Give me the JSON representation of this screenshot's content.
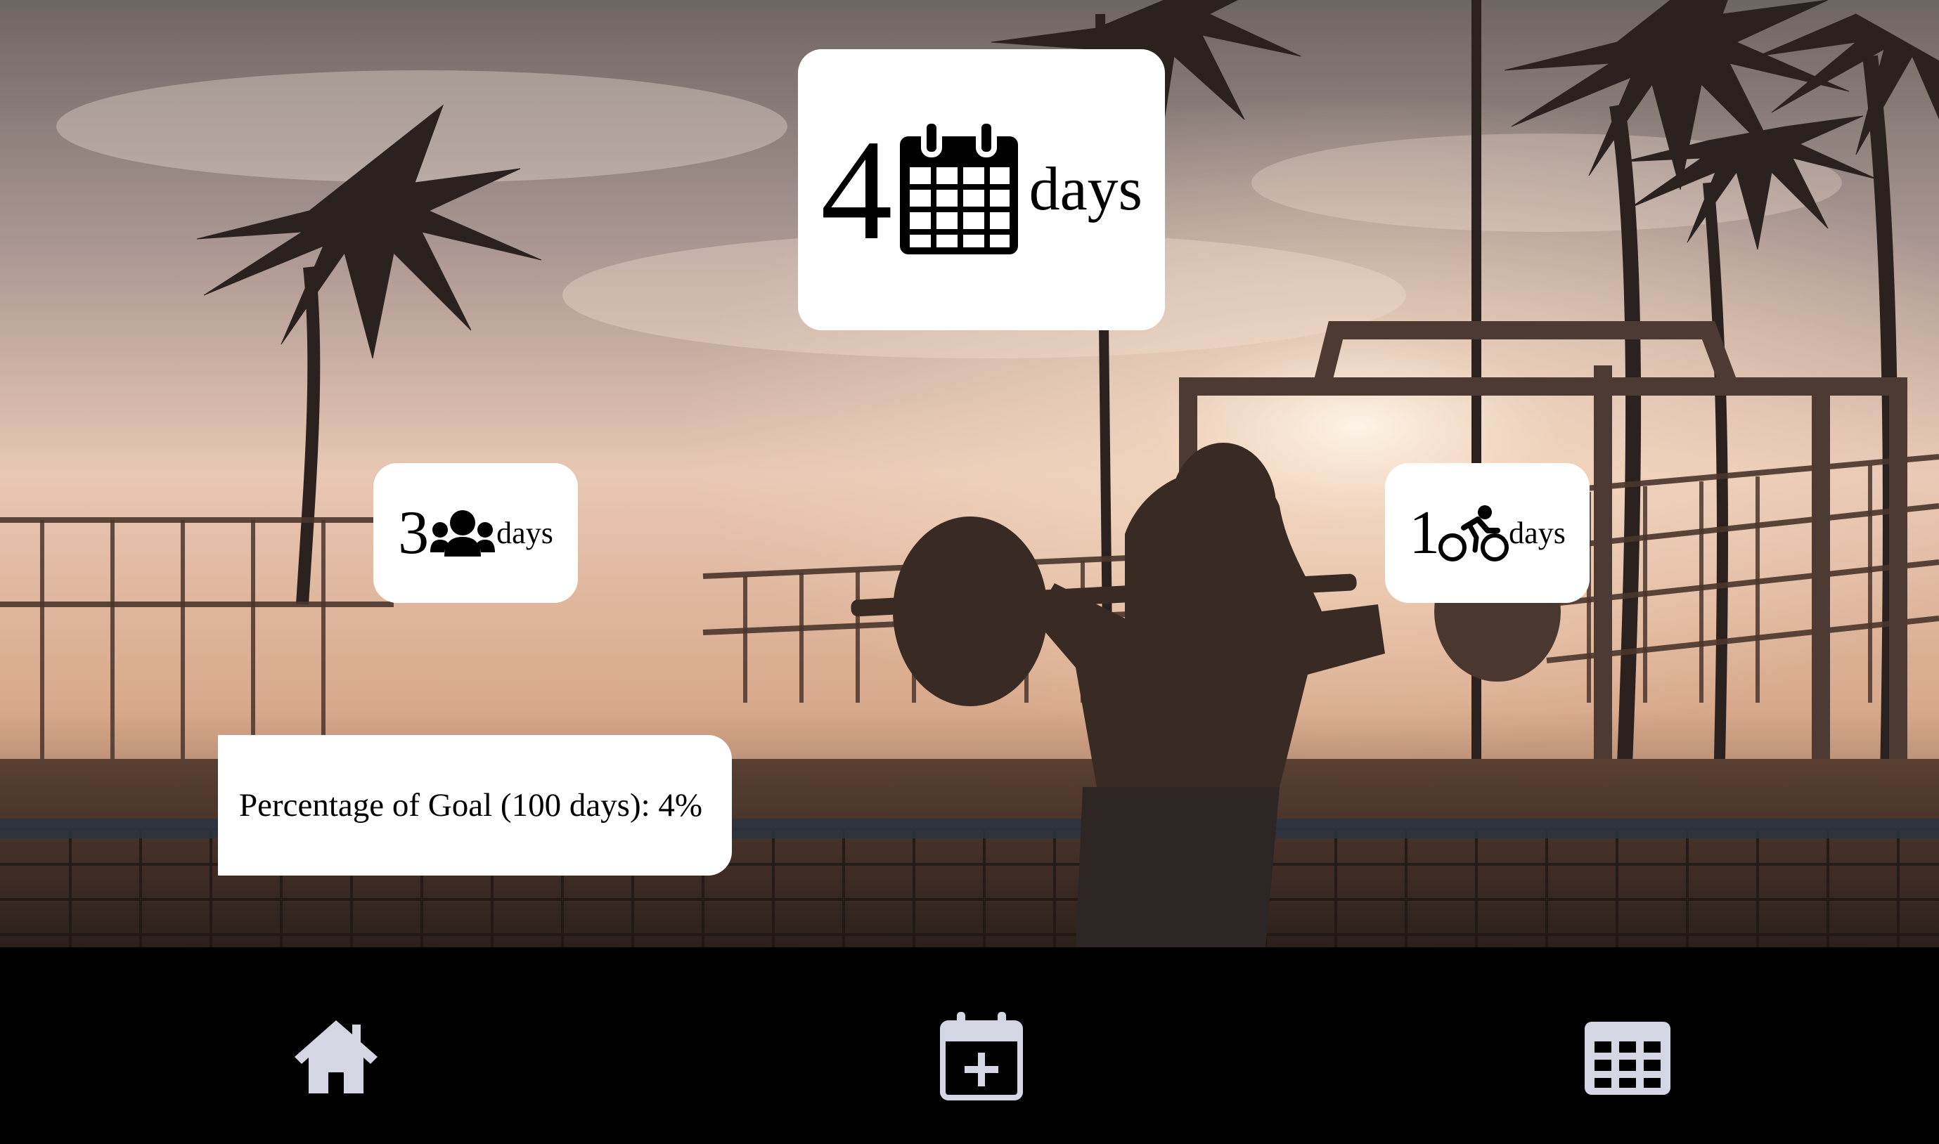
{
  "stats": {
    "main": {
      "value": "4",
      "unit": "days",
      "icon": "calendar-icon"
    },
    "group": {
      "value": "3",
      "unit": "days",
      "icon": "users-icon"
    },
    "cycling": {
      "value": "1",
      "unit": "days",
      "icon": "cycling-icon"
    }
  },
  "goal": {
    "text": "Percentage of Goal (100 days): 4%",
    "progress_percent": 4
  },
  "nav": {
    "items": [
      {
        "icon": "home-icon"
      },
      {
        "icon": "calendar-plus-icon"
      },
      {
        "icon": "table-icon"
      }
    ]
  },
  "colors": {
    "nav_background": "#000000",
    "nav_icon": "#d4d6e4",
    "card_background": "#ffffff"
  }
}
